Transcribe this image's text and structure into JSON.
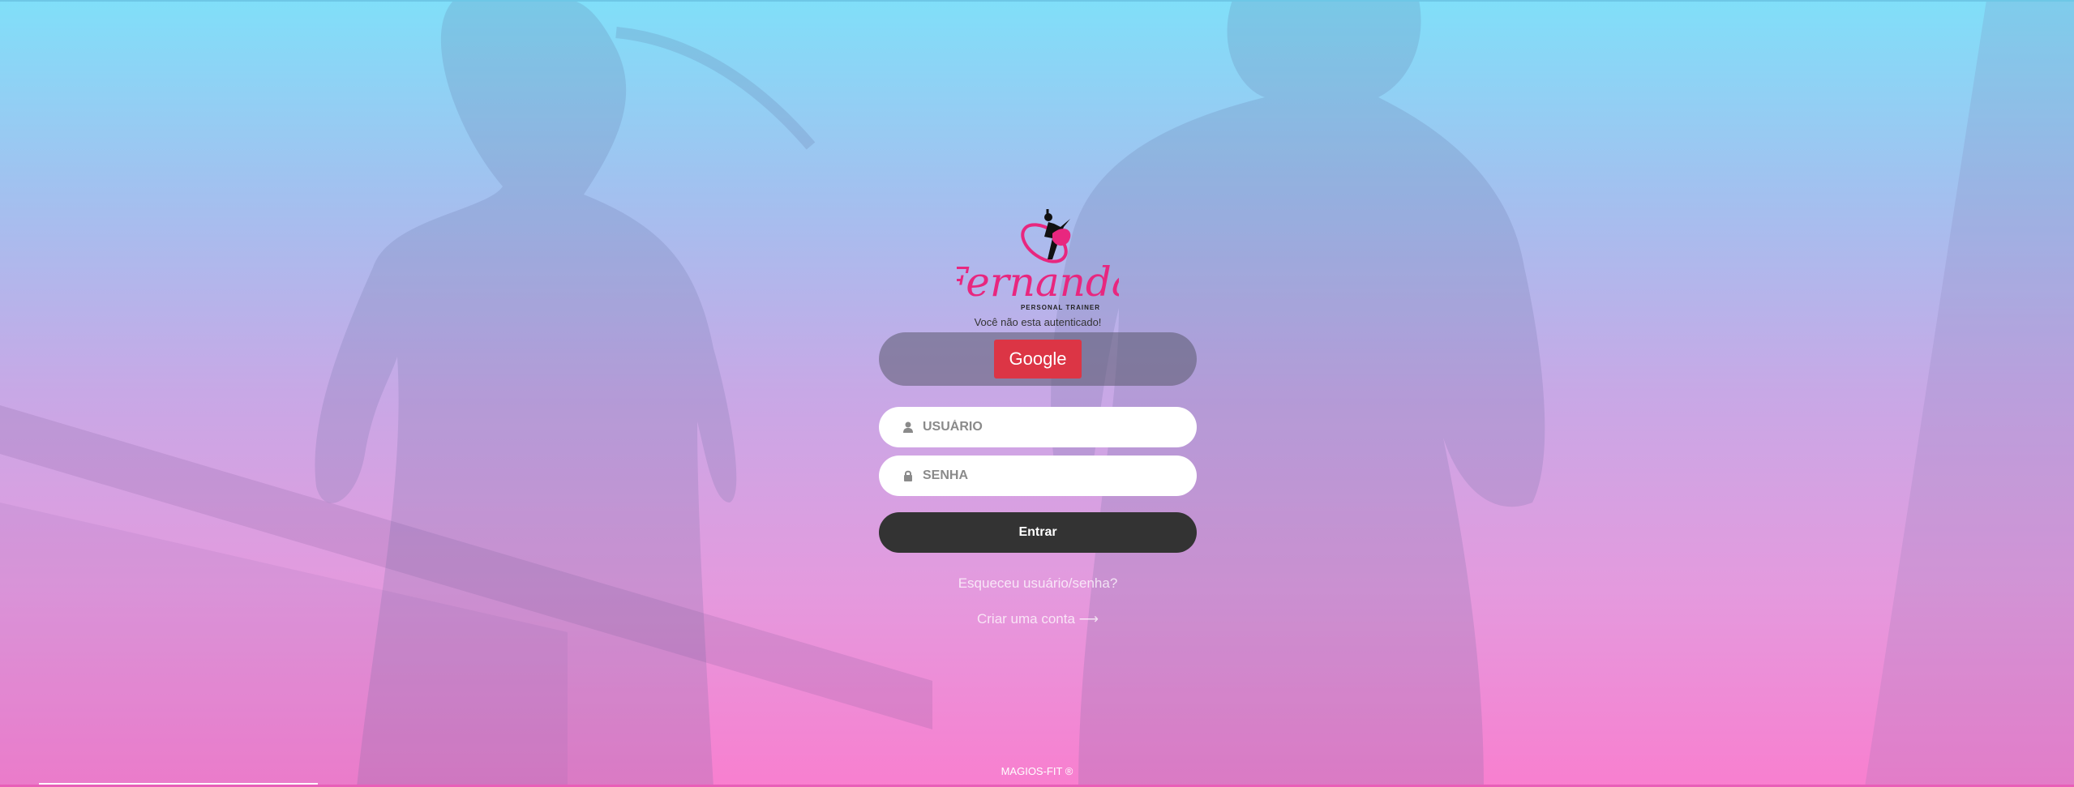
{
  "logo": {
    "script_text": "Fernanda",
    "subtitle": "PERSONAL TRAINER"
  },
  "auth": {
    "status_text": "Você não esta autenticado!",
    "google_label": "Google",
    "username_placeholder": "USUÁRIO",
    "password_placeholder": "SENHA",
    "submit_label": "Entrar"
  },
  "links": {
    "forgot": "Esqueceu usuário/senha?",
    "create_account": "Criar uma conta ⟶"
  },
  "footer": {
    "brand": "MAGIOS-FIT ®"
  },
  "icons": {
    "username": "user-icon",
    "password": "lock-icon",
    "logo": "dancer-logo-icon"
  },
  "colors": {
    "gradient_top": "#80dff9",
    "gradient_bottom": "#f87fcf",
    "logo_pink": "#e8277f",
    "google_red": "#dc3545",
    "submit_dark": "#333333"
  }
}
